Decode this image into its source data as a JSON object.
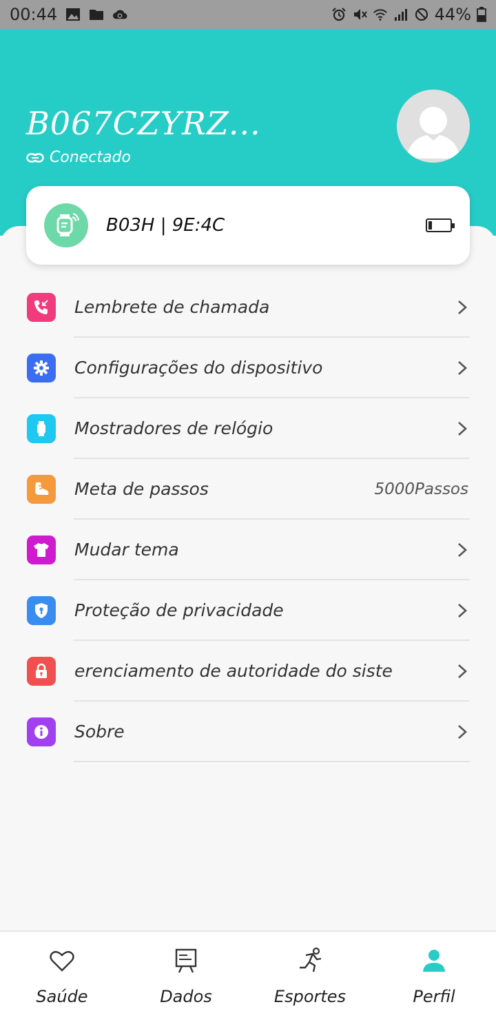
{
  "status_bar": {
    "time": "00:44",
    "battery_text": "44%"
  },
  "header": {
    "device_name": "B067CZYRZ...",
    "connection_status": "Conectado"
  },
  "device_card": {
    "device_id": "B03H | 9E:4C",
    "battery_level": 0.15
  },
  "menu": {
    "items": [
      {
        "label": "Lembrete de chamada",
        "icon": "phone-icon",
        "color": "#f03c7c"
      },
      {
        "label": "Configurações do dispositivo",
        "icon": "gear-icon",
        "color": "#3a6df0"
      },
      {
        "label": "Mostradores de relógio",
        "icon": "watch-icon",
        "color": "#1ec8f0"
      },
      {
        "label": "Meta de passos",
        "icon": "shoe-icon",
        "color": "#f59a3c",
        "value": "5000Passos"
      },
      {
        "label": "Mudar tema",
        "icon": "shirt-icon",
        "color": "#d01ad0"
      },
      {
        "label": "Proteção de privacidade",
        "icon": "shield-icon",
        "color": "#3a8df0"
      },
      {
        "label": "erenciamento de autoridade do sistema",
        "icon": "lock-icon",
        "color": "#f05050"
      },
      {
        "label": "Sobre",
        "icon": "info-icon",
        "color": "#a040f0"
      }
    ]
  },
  "bottom_nav": {
    "tabs": [
      {
        "label": "Saúde",
        "icon": "heart-icon"
      },
      {
        "label": "Dados",
        "icon": "chart-board-icon"
      },
      {
        "label": "Esportes",
        "icon": "runner-icon"
      },
      {
        "label": "Perfil",
        "icon": "profile-icon",
        "active": true
      }
    ],
    "active_color": "#26cdc6"
  },
  "colors": {
    "header": "#26cdc6",
    "watch_circle": "#6dd8a8"
  }
}
